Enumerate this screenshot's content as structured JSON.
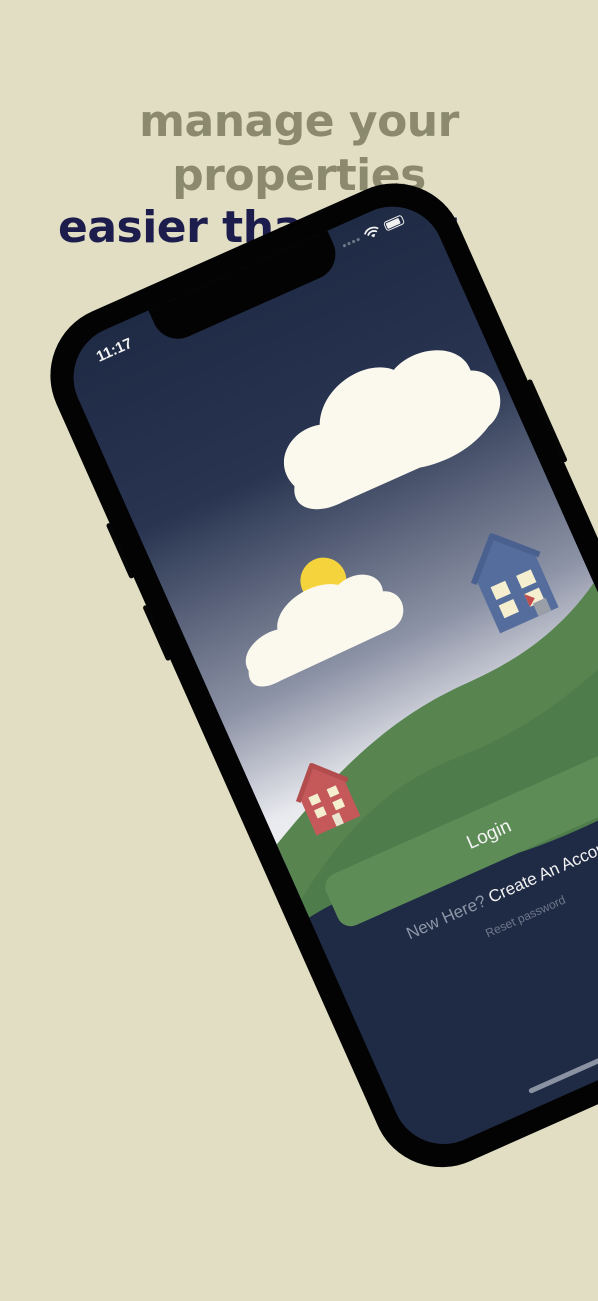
{
  "headline": {
    "line1": "manage your",
    "line2": "properties",
    "line3": "easier than ever"
  },
  "status_bar": {
    "time": "11:17",
    "icons": [
      "signal-icon",
      "wifi-icon",
      "battery-icon"
    ]
  },
  "login": {
    "button_label": "Login",
    "new_here_text": "New Here?",
    "create_account_label": "Create An Account",
    "reset_password_label": "Reset password"
  },
  "colors": {
    "background": "#e1dec4",
    "headline_muted": "#8b8a6f",
    "headline_accent": "#1d1d4d",
    "screen_bg": "#1f2b45",
    "primary_button": "#5d8c57"
  }
}
